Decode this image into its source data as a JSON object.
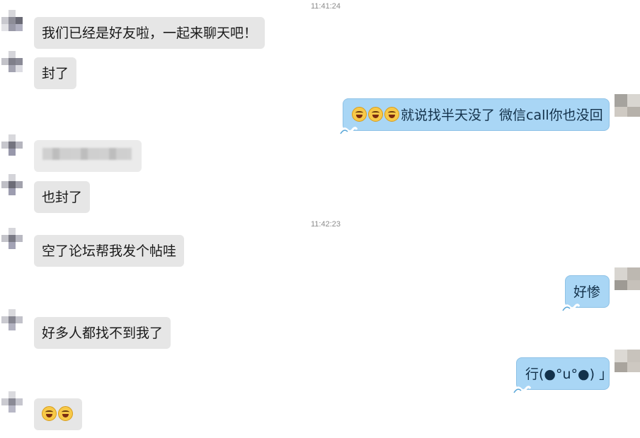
{
  "timestamps": [
    "11:41:24",
    "11:42:23"
  ],
  "messages": [
    {
      "side": "left",
      "text": "我们已经是好友啦，一起来聊天吧！"
    },
    {
      "side": "left",
      "text": "封了"
    },
    {
      "side": "right",
      "text": "就说找半天没了 微信call你也没回",
      "emoji_count": 3
    },
    {
      "side": "left",
      "text": "",
      "blurred": true
    },
    {
      "side": "left",
      "text": "也封了"
    },
    {
      "side": "left",
      "text": "空了论坛帮我发个帖哇"
    },
    {
      "side": "right",
      "text": "好惨"
    },
    {
      "side": "left",
      "text": "好多人都找不到我了"
    },
    {
      "side": "right",
      "text": "行(●°u°●)​ 」"
    },
    {
      "side": "left",
      "text": "",
      "emoji_count": 2
    }
  ],
  "colors": {
    "left_bubble": "#e6e6e6",
    "right_bubble": "#a9d6f5",
    "timestamp": "#8c8c8c"
  },
  "icons": [
    "laughing-tears-emoji",
    "wave-decoration-icon",
    "pixelated-avatar"
  ]
}
